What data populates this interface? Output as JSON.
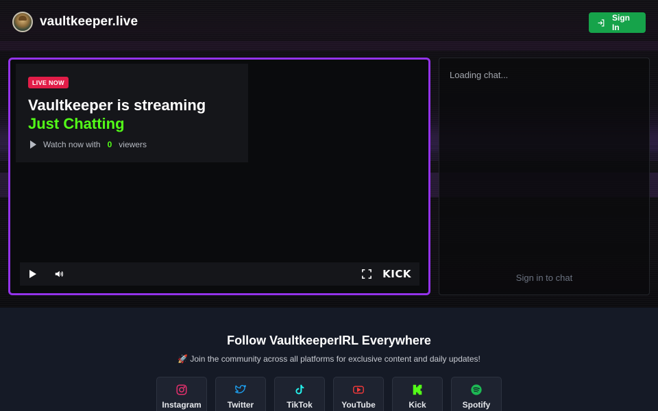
{
  "header": {
    "site_name": "vaultkeeper.live",
    "signin_label": "Sign In"
  },
  "player": {
    "badge": "LIVE NOW",
    "title": "Vaultkeeper is streaming",
    "category": "Just Chatting",
    "watch_prefix": "Watch now with",
    "viewer_count": "0",
    "viewers_suffix": "viewers",
    "platform_logo": "KICK"
  },
  "chat": {
    "loading": "Loading chat...",
    "signin_prompt": "Sign in to chat"
  },
  "follow": {
    "title": "Follow VaultkeeperIRL Everywhere",
    "subtitle": "🚀 Join the community across all platforms for exclusive content and daily updates!",
    "socials": [
      {
        "label": "Instagram",
        "icon": "instagram-icon",
        "color": "#e1306c"
      },
      {
        "label": "Twitter",
        "icon": "twitter-icon",
        "color": "#1da1f2"
      },
      {
        "label": "TikTok",
        "icon": "tiktok-icon",
        "color": "#25f4ee"
      },
      {
        "label": "YouTube",
        "icon": "youtube-icon",
        "color": "#ff0000"
      },
      {
        "label": "Kick",
        "icon": "kick-icon",
        "color": "#53fc18"
      },
      {
        "label": "Spotify",
        "icon": "spotify-icon",
        "color": "#1db954"
      }
    ]
  },
  "colors": {
    "accent_purple": "#9333ea",
    "kick_green": "#53fc18",
    "live_red": "#e11d48",
    "signin_green": "#16a34a"
  }
}
